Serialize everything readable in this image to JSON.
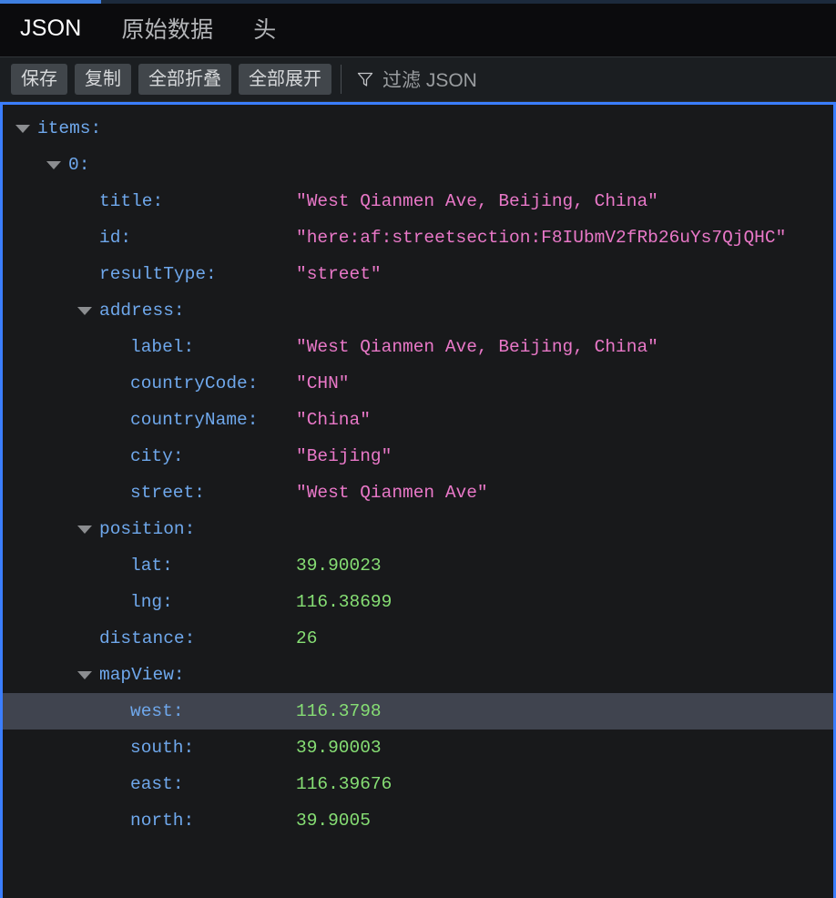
{
  "tabs": [
    {
      "label": "JSON",
      "active": true,
      "name": "tab-json"
    },
    {
      "label": "原始数据",
      "active": false,
      "name": "tab-raw-data"
    },
    {
      "label": "头",
      "active": false,
      "name": "tab-headers"
    }
  ],
  "toolbar": {
    "save_label": "保存",
    "copy_label": "复制",
    "collapse_all_label": "全部折叠",
    "expand_all_label": "全部展开",
    "filter_placeholder": "过滤 JSON",
    "filter_value": ""
  },
  "colors": {
    "tab_active_underline": "#3f7fe0",
    "panel_focus_border": "#3b7eff",
    "key": "#6fa8ec",
    "string_value": "#e978c8",
    "number_value": "#86de74",
    "selected_row_bg": "#40444f",
    "panel_bg": "#18191b",
    "toolbar_bg": "#1b1e21",
    "tabbar_bg": "#0b0b0d"
  },
  "json_tree": {
    "rows": [
      {
        "indent": 0,
        "expander": "expanded",
        "key": "items",
        "value": "",
        "type": "none",
        "selected": false
      },
      {
        "indent": 1,
        "expander": "expanded",
        "key": "0",
        "value": "",
        "type": "none",
        "selected": false
      },
      {
        "indent": 2,
        "expander": "none",
        "key": "title",
        "value": "\"West Qianmen Ave, Beijing, China\"",
        "type": "string",
        "selected": false
      },
      {
        "indent": 2,
        "expander": "none",
        "key": "id",
        "value": "\"here:af:streetsection:F8IUbmV2fRb26uYs7QjQHC\"",
        "type": "string",
        "selected": false
      },
      {
        "indent": 2,
        "expander": "none",
        "key": "resultType",
        "value": "\"street\"",
        "type": "string",
        "selected": false
      },
      {
        "indent": 2,
        "expander": "expanded",
        "key": "address",
        "value": "",
        "type": "none",
        "selected": false
      },
      {
        "indent": 3,
        "expander": "none",
        "key": "label",
        "value": "\"West Qianmen Ave, Beijing, China\"",
        "type": "string",
        "selected": false
      },
      {
        "indent": 3,
        "expander": "none",
        "key": "countryCode",
        "value": "\"CHN\"",
        "type": "string",
        "selected": false
      },
      {
        "indent": 3,
        "expander": "none",
        "key": "countryName",
        "value": "\"China\"",
        "type": "string",
        "selected": false
      },
      {
        "indent": 3,
        "expander": "none",
        "key": "city",
        "value": "\"Beijing\"",
        "type": "string",
        "selected": false
      },
      {
        "indent": 3,
        "expander": "none",
        "key": "street",
        "value": "\"West Qianmen Ave\"",
        "type": "string",
        "selected": false
      },
      {
        "indent": 2,
        "expander": "expanded",
        "key": "position",
        "value": "",
        "type": "none",
        "selected": false
      },
      {
        "indent": 3,
        "expander": "none",
        "key": "lat",
        "value": "39.90023",
        "type": "number",
        "selected": false
      },
      {
        "indent": 3,
        "expander": "none",
        "key": "lng",
        "value": "116.38699",
        "type": "number",
        "selected": false
      },
      {
        "indent": 2,
        "expander": "none",
        "key": "distance",
        "value": "26",
        "type": "number",
        "selected": false
      },
      {
        "indent": 2,
        "expander": "expanded",
        "key": "mapView",
        "value": "",
        "type": "none",
        "selected": false
      },
      {
        "indent": 3,
        "expander": "none",
        "key": "west",
        "value": "116.3798",
        "type": "number",
        "selected": true
      },
      {
        "indent": 3,
        "expander": "none",
        "key": "south",
        "value": "39.90003",
        "type": "number",
        "selected": false
      },
      {
        "indent": 3,
        "expander": "none",
        "key": "east",
        "value": "116.39676",
        "type": "number",
        "selected": false
      },
      {
        "indent": 3,
        "expander": "none",
        "key": "north",
        "value": "39.9005",
        "type": "number",
        "selected": false
      }
    ]
  }
}
